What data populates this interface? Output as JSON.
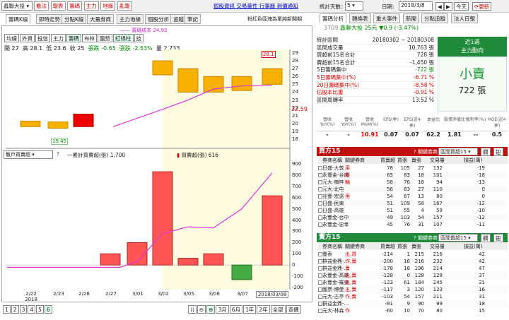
{
  "top": {
    "stock_select": "鑫聯大投",
    "buttons": [
      "看法",
      "報表",
      "籌碼",
      "主力",
      "地緣",
      "亂報"
    ],
    "links": [
      "個股資訊",
      "交易量性",
      "行事曆",
      "到價通知"
    ],
    "nav_label": "統計天數：",
    "days": "5",
    "date_label": "日期:",
    "date": "2018/3/8",
    "today": "今天",
    "refresh": "更新"
  },
  "left_tabs": [
    "籌碼K線",
    "即時走勢",
    "分點K線",
    "大量券商",
    "主力地緣",
    "個股分析",
    "追蹤",
    "筆記"
  ],
  "note": "粉紅色區塊為單純新聞期",
  "legend_top": "籌碼成本 24.93",
  "sub_btns": [
    "均線",
    "外資",
    "投信",
    "主力",
    "籌碼",
    "布林",
    "趨勢",
    "紅綠柱",
    "技"
  ],
  "ohlc": {
    "open": "開 27",
    "high": "高 28.1",
    "low": "低 23.6",
    "close": "收 25",
    "chg": "張跌 -0.65",
    "pct": "張跌 -2.53%",
    "vol": "量 2,733"
  },
  "price_axis": [
    "29",
    "28",
    "27",
    "26",
    "25",
    "24",
    "23",
    "22",
    "21",
    "20",
    "19",
    "18"
  ],
  "price_now": "22.59",
  "max_label": "28.1",
  "min_label": "19.45",
  "lower_legend": {
    "select": "散戶買賣超",
    "l1": "一累計買賣超(張) 1,700",
    "l2": "買賣超(張) 616"
  },
  "lower_axis": [
    "900",
    "800",
    "700",
    "600",
    "500",
    "400",
    "300",
    "200",
    "100",
    "0",
    "-100",
    "-200"
  ],
  "x_labels": [
    "2/22\n2018",
    "2/23",
    "2/26",
    "2/27",
    "3/01",
    "3/02",
    "3/05",
    "3/06",
    "3/07",
    "2018/03/08"
  ],
  "bottom": {
    "pages": [
      "1",
      "2",
      "3",
      "4",
      "5",
      "6"
    ],
    "ranges": [
      "3月",
      "6月",
      "1年",
      "2年",
      "全部",
      "查價"
    ]
  },
  "right_tabs": [
    "籌碼分析",
    "轉換表",
    "重大事件",
    "新聞",
    "分點追蹤",
    "法人日報"
  ],
  "stock": {
    "code": "3709",
    "name": "鑫聯大投",
    "price": "25元",
    "chg": "▼0.9 (-3.47%)"
  },
  "stats": [
    [
      "統計區間",
      "20180302 ~ 20180308"
    ],
    [
      "區間成交量",
      "10,763 張"
    ],
    [
      "買超前15名合計",
      "728 張"
    ],
    [
      "賣超前15名合計",
      "-1,450 張"
    ],
    [
      "5日籌碼集中",
      "-722 張"
    ],
    [
      "5日籌碼集中(%)",
      "-6.71 %"
    ],
    [
      "20日籌碼集中(%)",
      "-8.58 %"
    ],
    [
      "佔股本比重",
      "-0.91 %"
    ],
    [
      "區間周轉率",
      "13.52 %"
    ]
  ],
  "summary": {
    "title": "近1週",
    "sub": "主力動向",
    "verdict": "小賣",
    "amount": "722 張"
  },
  "metrics_head": [
    "營收YoY(%)",
    "營收YoY(%)",
    "營收MoM(%)",
    "EPS(季)",
    "EPS(近4季)",
    "本益比",
    "股價淨值比",
    "殖利率(%)",
    "ROE(近4季)"
  ],
  "metrics": [
    "-",
    "-",
    "10.91",
    "0.07",
    "0.07",
    "62.2",
    "1.81",
    "--",
    "0.5"
  ],
  "buy": {
    "title": "買方15",
    "filter": "關鍵券商",
    "sel": "區間買超15",
    "b1": "欄",
    "b2": "鈕",
    "cols": [
      "券商名稱",
      "關鍵券商",
      "買賣超",
      "買張",
      "賣張",
      "交易量",
      "損益(萬)"
    ],
    "rows": [
      [
        "日盛-大敦",
        "用",
        "78",
        "105",
        "27",
        "132",
        "-19"
      ],
      [
        "永豐金-台南",
        "用",
        "65",
        "83",
        "18",
        "101",
        "-18"
      ],
      [
        "元大-楠梓",
        "輪",
        "58",
        "76",
        "18",
        "94",
        "-13"
      ],
      [
        "元大-北屯",
        "",
        "56",
        "83",
        "27",
        "110",
        "0"
      ],
      [
        "兆豐-宏遠",
        "用",
        "54",
        "67",
        "13",
        "80",
        "0"
      ],
      [
        "日盛-民東",
        "",
        "51",
        "109",
        "58",
        "167",
        "-12"
      ],
      [
        "日盛-高雄",
        "",
        "51",
        "55",
        "4",
        "59",
        "-10"
      ],
      [
        "永豐金-台中",
        "",
        "49",
        "103",
        "54",
        "157",
        "-12"
      ],
      [
        "永豐金-忠孝",
        "",
        "45",
        "76",
        "31",
        "107",
        "-11"
      ]
    ]
  },
  "sell": {
    "title": "賣方15",
    "filter": "關鍵券商",
    "sel": "區間賣超15",
    "b1": "欄",
    "b2": "鈕",
    "cols": [
      "券商名稱",
      "關鍵券商",
      "買賣超",
      "買張",
      "賣張",
      "交易量",
      "損益(萬)"
    ],
    "rows": [
      [
        "豐表",
        "出,買",
        "-214",
        "1",
        "215",
        "216",
        "42"
      ],
      [
        "群益金鼎-...",
        "作,賣",
        "-200",
        "16",
        "216",
        "232",
        "42"
      ],
      [
        "群益金鼎-...",
        "賣",
        "-178",
        "18",
        "196",
        "214",
        "47"
      ],
      [
        "永豐金-高雄",
        "出,賣",
        "-128",
        "0",
        "128",
        "128",
        "37"
      ],
      [
        "永豐金-羅東",
        "出,賣",
        "-123",
        "61",
        "184",
        "245",
        "21"
      ],
      [
        "國票-博愛",
        "出,賣",
        "-117",
        "3",
        "120",
        "123",
        "16"
      ],
      [
        "元大-古亭",
        "作,賣",
        "-103",
        "54",
        "157",
        "211",
        "31"
      ],
      [
        "群益金鼎-...",
        "",
        "-81",
        "9",
        "90",
        "99",
        "18"
      ],
      [
        "元大-林森",
        "作",
        "-60",
        "10",
        "70",
        "80",
        "15"
      ]
    ]
  },
  "chart_data": {
    "type": "bar",
    "categories": [
      "2/22",
      "2/23",
      "2/26",
      "2/27",
      "3/01",
      "3/02",
      "3/05",
      "3/06",
      "3/07",
      "2018/03/08"
    ],
    "candles": [
      {
        "o": 20.3,
        "c": 19.6
      },
      {
        "o": 20.2,
        "c": 19.4
      },
      {
        "o": 21.2,
        "c": 19.6
      },
      null,
      null,
      {
        "o": 28.0,
        "c": 26.2
      },
      {
        "o": 27.0,
        "c": 24.0
      },
      {
        "o": 26.0,
        "c": 24.0
      },
      {
        "o": 26.0,
        "c": 24.2
      },
      {
        "o": 27.0,
        "c": 25.0
      }
    ],
    "ma": [
      null,
      null,
      null,
      null,
      null,
      21.8,
      23.0,
      24.4,
      24.8,
      24.9
    ],
    "bars": [
      0,
      0,
      0,
      100,
      200,
      830,
      60,
      100,
      -130,
      616
    ],
    "cum": [
      0,
      0,
      0,
      0,
      0,
      0,
      0,
      0,
      0,
      0
    ],
    "ylim_price": [
      18,
      29
    ],
    "ylim_vol": [
      -200,
      900
    ]
  }
}
